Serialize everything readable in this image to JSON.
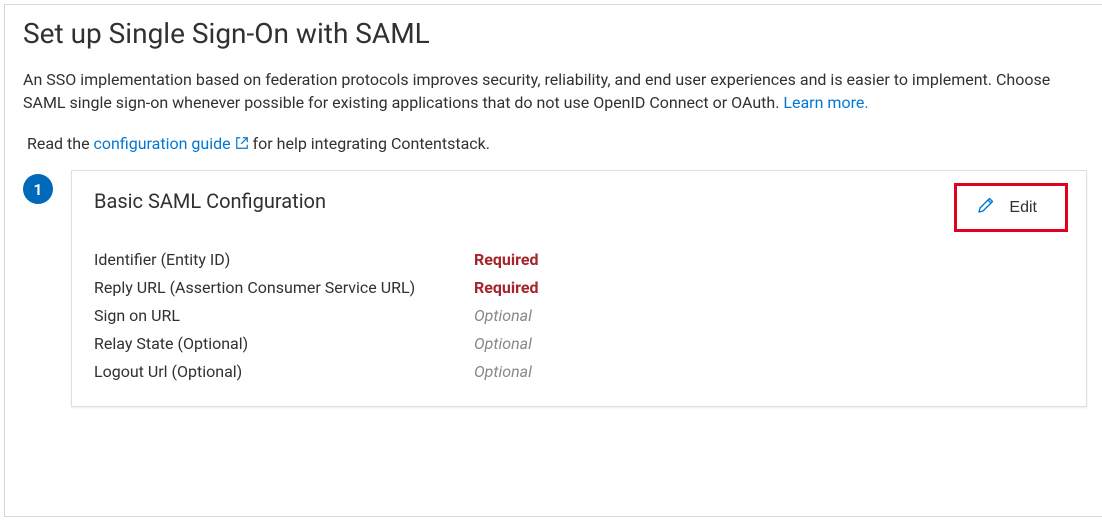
{
  "pageTitle": "Set up Single Sign-On with SAML",
  "introPrefix": "An SSO implementation based on federation protocols improves security, reliability, and end user experiences and is easier to implement. Choose SAML single sign-on whenever possible for existing applications that do not use OpenID Connect or OAuth. ",
  "learnMoreLabel": "Learn more.",
  "helpPrefix": "Read the ",
  "configGuideLabel": "configuration guide",
  "helpSuffix": " for help integrating Contentstack.",
  "stepNumber": "1",
  "card": {
    "title": "Basic SAML Configuration",
    "editLabel": "Edit",
    "fields": {
      "identifierLabel": "Identifier (Entity ID)",
      "identifierValue": "Required",
      "replyLabel": "Reply URL (Assertion Consumer Service URL)",
      "replyValue": "Required",
      "signOnLabel": "Sign on URL",
      "signOnValue": "Optional",
      "relayLabel": "Relay State (Optional)",
      "relayValue": "Optional",
      "logoutLabel": "Logout Url (Optional)",
      "logoutValue": "Optional"
    }
  }
}
